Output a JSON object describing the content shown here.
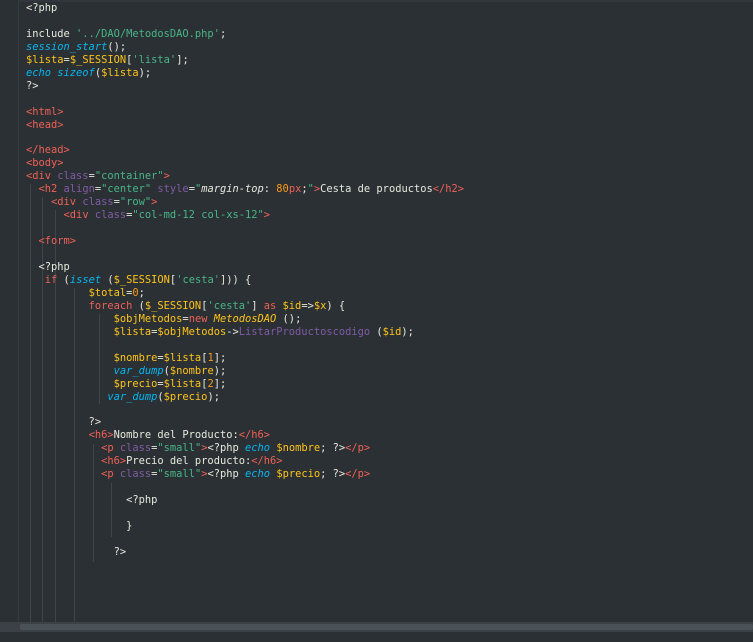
{
  "editor": {
    "theme_colors": {
      "background": "#2b3035",
      "keyword": "#ef6155",
      "string": "#48b685",
      "variable": "#fec418",
      "number": "#f99b15",
      "function": "#06b6ef",
      "attribute": "#815ba4",
      "text": "#e7e9db"
    },
    "lines": [
      [
        [
          "plain",
          "<?php"
        ]
      ],
      [],
      [
        [
          "plain",
          "include "
        ],
        [
          "str",
          "'../DAO/MetodosDAO.php'"
        ],
        [
          "plain",
          ";"
        ]
      ],
      [
        [
          "fn",
          "session_start"
        ],
        [
          "plain",
          "();"
        ]
      ],
      [
        [
          "var",
          "$lista"
        ],
        [
          "plain",
          "="
        ],
        [
          "var",
          "$_SESSION"
        ],
        [
          "plain",
          "["
        ],
        [
          "str",
          "'lista'"
        ],
        [
          "plain",
          "];"
        ]
      ],
      [
        [
          "fn",
          "echo sizeof"
        ],
        [
          "plain",
          "("
        ],
        [
          "var",
          "$lista"
        ],
        [
          "plain",
          ");"
        ]
      ],
      [
        [
          "plain",
          "?>"
        ]
      ],
      [],
      [
        [
          "tag",
          "<html>"
        ]
      ],
      [
        [
          "tag",
          "<head>"
        ]
      ],
      [],
      [
        [
          "tag",
          "</head>"
        ]
      ],
      [
        [
          "tag",
          "<body>"
        ]
      ],
      [
        [
          "tag",
          "<div "
        ],
        [
          "attr",
          "class"
        ],
        [
          "plain",
          "="
        ],
        [
          "str",
          "\"container\""
        ],
        [
          "tag",
          ">"
        ]
      ],
      [
        [
          "plain",
          "  "
        ],
        [
          "tag",
          "<h2 "
        ],
        [
          "attr",
          "align"
        ],
        [
          "plain",
          "="
        ],
        [
          "str",
          "\"center\""
        ],
        [
          "plain",
          " "
        ],
        [
          "attr",
          "style"
        ],
        [
          "plain",
          "="
        ],
        [
          "str",
          "\""
        ],
        [
          "it",
          "margin-top"
        ],
        [
          "plain",
          ": "
        ],
        [
          "num",
          "80"
        ],
        [
          "kw",
          "px"
        ],
        [
          "plain",
          ";"
        ],
        [
          "str",
          "\""
        ],
        [
          "tag",
          ">"
        ],
        [
          "plain",
          "Cesta de productos"
        ],
        [
          "tag",
          "</h2>"
        ]
      ],
      [
        [
          "plain",
          "    "
        ],
        [
          "tag",
          "<div "
        ],
        [
          "attr",
          "class"
        ],
        [
          "plain",
          "="
        ],
        [
          "str",
          "\"row\""
        ],
        [
          "tag",
          ">"
        ]
      ],
      [
        [
          "plain",
          "      "
        ],
        [
          "tag",
          "<div "
        ],
        [
          "attr",
          "class"
        ],
        [
          "plain",
          "="
        ],
        [
          "str",
          "\"col-md-12 col-xs-12\""
        ],
        [
          "tag",
          ">"
        ]
      ],
      [],
      [
        [
          "plain",
          "  "
        ],
        [
          "tag",
          "<form>"
        ]
      ],
      [],
      [
        [
          "plain",
          "  <?php"
        ]
      ],
      [
        [
          "plain",
          "   "
        ],
        [
          "kw",
          "if"
        ],
        [
          "plain",
          " ("
        ],
        [
          "fn",
          "isset"
        ],
        [
          "plain",
          " ("
        ],
        [
          "var",
          "$_SESSION"
        ],
        [
          "plain",
          "["
        ],
        [
          "str",
          "'cesta'"
        ],
        [
          "plain",
          "])) {"
        ]
      ],
      [
        [
          "plain",
          "          "
        ],
        [
          "var",
          "$total"
        ],
        [
          "plain",
          "="
        ],
        [
          "num",
          "0"
        ],
        [
          "plain",
          ";"
        ]
      ],
      [
        [
          "plain",
          "          "
        ],
        [
          "kw",
          "foreach"
        ],
        [
          "plain",
          " ("
        ],
        [
          "var",
          "$_SESSION"
        ],
        [
          "plain",
          "["
        ],
        [
          "str",
          "'cesta'"
        ],
        [
          "plain",
          "] "
        ],
        [
          "kw",
          "as"
        ],
        [
          "plain",
          " "
        ],
        [
          "var",
          "$id"
        ],
        [
          "plain",
          "=>"
        ],
        [
          "var",
          "$x"
        ],
        [
          "plain",
          ") {"
        ]
      ],
      [
        [
          "plain",
          "              "
        ],
        [
          "var",
          "$objMetodos"
        ],
        [
          "plain",
          "="
        ],
        [
          "kw",
          "new"
        ],
        [
          "plain",
          " "
        ],
        [
          "cls",
          "MetodosDAO"
        ],
        [
          "plain",
          " ();"
        ]
      ],
      [
        [
          "plain",
          "              "
        ],
        [
          "var",
          "$lista"
        ],
        [
          "plain",
          "="
        ],
        [
          "var",
          "$objMetodos"
        ],
        [
          "plain",
          "->"
        ],
        [
          "fnn",
          "ListarProductoscodigo"
        ],
        [
          "plain",
          " ("
        ],
        [
          "var",
          "$id"
        ],
        [
          "plain",
          ");"
        ]
      ],
      [],
      [
        [
          "plain",
          "              "
        ],
        [
          "var",
          "$nombre"
        ],
        [
          "plain",
          "="
        ],
        [
          "var",
          "$lista"
        ],
        [
          "plain",
          "["
        ],
        [
          "num",
          "1"
        ],
        [
          "plain",
          "];"
        ]
      ],
      [
        [
          "plain",
          "              "
        ],
        [
          "fn",
          "var_dump"
        ],
        [
          "plain",
          "("
        ],
        [
          "var",
          "$nombre"
        ],
        [
          "plain",
          ");"
        ]
      ],
      [
        [
          "plain",
          "              "
        ],
        [
          "var",
          "$precio"
        ],
        [
          "plain",
          "="
        ],
        [
          "var",
          "$lista"
        ],
        [
          "plain",
          "["
        ],
        [
          "num",
          "2"
        ],
        [
          "plain",
          "];"
        ]
      ],
      [
        [
          "plain",
          "             "
        ],
        [
          "fn",
          "var_dump"
        ],
        [
          "plain",
          "("
        ],
        [
          "var",
          "$precio"
        ],
        [
          "plain",
          ");"
        ]
      ],
      [],
      [
        [
          "plain",
          "          ?>"
        ]
      ],
      [
        [
          "plain",
          "          "
        ],
        [
          "tag",
          "<h6>"
        ],
        [
          "plain",
          "Nombre del Producto:"
        ],
        [
          "tag",
          "</h6>"
        ]
      ],
      [
        [
          "plain",
          "            "
        ],
        [
          "tag",
          "<p "
        ],
        [
          "attr",
          "class"
        ],
        [
          "plain",
          "="
        ],
        [
          "str",
          "\"small\""
        ],
        [
          "tag",
          ">"
        ],
        [
          "plain",
          "<?php "
        ],
        [
          "fn",
          "echo"
        ],
        [
          "plain",
          " "
        ],
        [
          "var",
          "$nombre"
        ],
        [
          "plain",
          "; ?>"
        ],
        [
          "tag",
          "</p>"
        ]
      ],
      [
        [
          "plain",
          "            "
        ],
        [
          "tag",
          "<h6>"
        ],
        [
          "plain",
          "Precio del producto:"
        ],
        [
          "tag",
          "</h6>"
        ]
      ],
      [
        [
          "plain",
          "            "
        ],
        [
          "tag",
          "<p "
        ],
        [
          "attr",
          "class"
        ],
        [
          "plain",
          "="
        ],
        [
          "str",
          "\"small\""
        ],
        [
          "tag",
          ">"
        ],
        [
          "plain",
          "<?php "
        ],
        [
          "fn",
          "echo"
        ],
        [
          "plain",
          " "
        ],
        [
          "var",
          "$precio"
        ],
        [
          "plain",
          "; ?>"
        ],
        [
          "tag",
          "</p>"
        ]
      ],
      [],
      [
        [
          "plain",
          "                <?php"
        ]
      ],
      [],
      [
        [
          "plain",
          "                }"
        ]
      ],
      [],
      [
        [
          "plain",
          "              ?>"
        ]
      ]
    ]
  }
}
